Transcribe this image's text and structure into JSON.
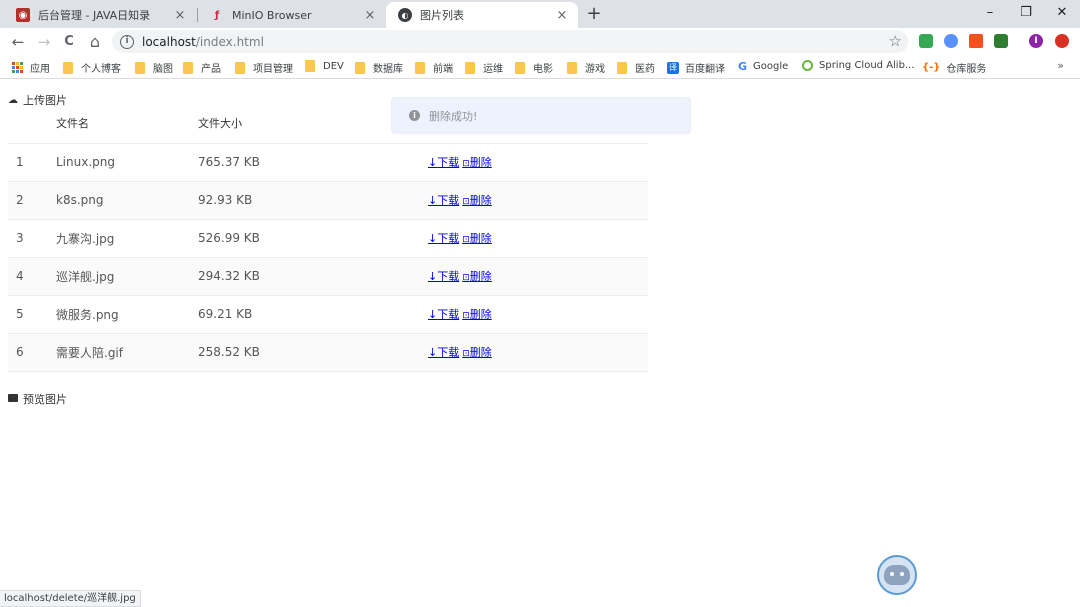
{
  "browser": {
    "tabs": [
      {
        "title": "后台管理 - JAVA日知录",
        "close": "×",
        "favicon_color": "#b5302a"
      },
      {
        "title": "MinIO Browser",
        "close": "×",
        "favicon_color": "#c72c48"
      },
      {
        "title": "图片列表",
        "close": "×",
        "favicon_color": "#3c4043",
        "active": true
      }
    ],
    "new_tab": "+",
    "window_controls": {
      "minimize": "–",
      "restore": "❐",
      "close": "✕"
    },
    "nav": {
      "back": "←",
      "forward": "→",
      "reload": "C",
      "home": "⌂"
    },
    "address": {
      "host": "localhost",
      "path": "/index.html",
      "info": "i",
      "star": "☆"
    },
    "bookmarks": [
      {
        "label": "应用",
        "kind": "apps"
      },
      {
        "label": "个人博客",
        "kind": "folder"
      },
      {
        "label": "脑图",
        "kind": "folder"
      },
      {
        "label": "产品",
        "kind": "folder"
      },
      {
        "label": "项目管理",
        "kind": "folder"
      },
      {
        "label": "DEV",
        "kind": "folder"
      },
      {
        "label": "数据库",
        "kind": "folder"
      },
      {
        "label": "前端",
        "kind": "folder"
      },
      {
        "label": "运维",
        "kind": "folder"
      },
      {
        "label": "电影",
        "kind": "folder"
      },
      {
        "label": "游戏",
        "kind": "folder"
      },
      {
        "label": "医药",
        "kind": "folder"
      },
      {
        "label": "百度翻译",
        "kind": "translate",
        "icon": "译"
      },
      {
        "label": "Google",
        "kind": "google",
        "icon": "G"
      },
      {
        "label": "Spring Cloud Alib...",
        "kind": "spring"
      },
      {
        "label": "仓库服务",
        "kind": "cangku",
        "icon": "{-}"
      }
    ],
    "bookmarks_more": "»",
    "status_url": "localhost/delete/巡洋舰.jpg",
    "extensions": [
      {
        "icon": "puzzle-icon",
        "color": "#34a853",
        "glyph": ""
      },
      {
        "icon": "shield-icon",
        "color": "#5b8ff9",
        "glyph": ""
      },
      {
        "icon": "stats-icon",
        "color": "#f4511e",
        "glyph": ""
      },
      {
        "icon": "b-icon",
        "color": "#2e7d32",
        "glyph": ""
      },
      {
        "icon": "profile-icon",
        "color": "#8e24aa",
        "glyph": "I"
      },
      {
        "icon": "record-icon",
        "color": "#d93025",
        "glyph": ""
      }
    ]
  },
  "page": {
    "upload_title": "上传图片",
    "preview_title": "预览图片",
    "table": {
      "headers": [
        "",
        "文件名",
        "文件大小",
        ""
      ],
      "rows": [
        {
          "index": "1",
          "name": "Linux.png",
          "size": "765.37 KB"
        },
        {
          "index": "2",
          "name": "k8s.png",
          "size": "92.93 KB"
        },
        {
          "index": "3",
          "name": "九寨沟.jpg",
          "size": "526.99 KB"
        },
        {
          "index": "4",
          "name": "巡洋舰.jpg",
          "size": "294.32 KB"
        },
        {
          "index": "5",
          "name": "微服务.png",
          "size": "69.21 KB"
        },
        {
          "index": "6",
          "name": "需要人陪.gif",
          "size": "258.52 KB"
        }
      ],
      "download_label": "下载",
      "delete_label": "删除",
      "download_icon": "↓",
      "delete_icon": "🗑"
    },
    "toast": {
      "message": "删除成功!",
      "icon": "i"
    }
  },
  "colors": {
    "tabstrip_bg": "#dee1e6",
    "toast_bg": "#edf2fc",
    "toast_text": "#909399",
    "link": "#0000ee"
  }
}
